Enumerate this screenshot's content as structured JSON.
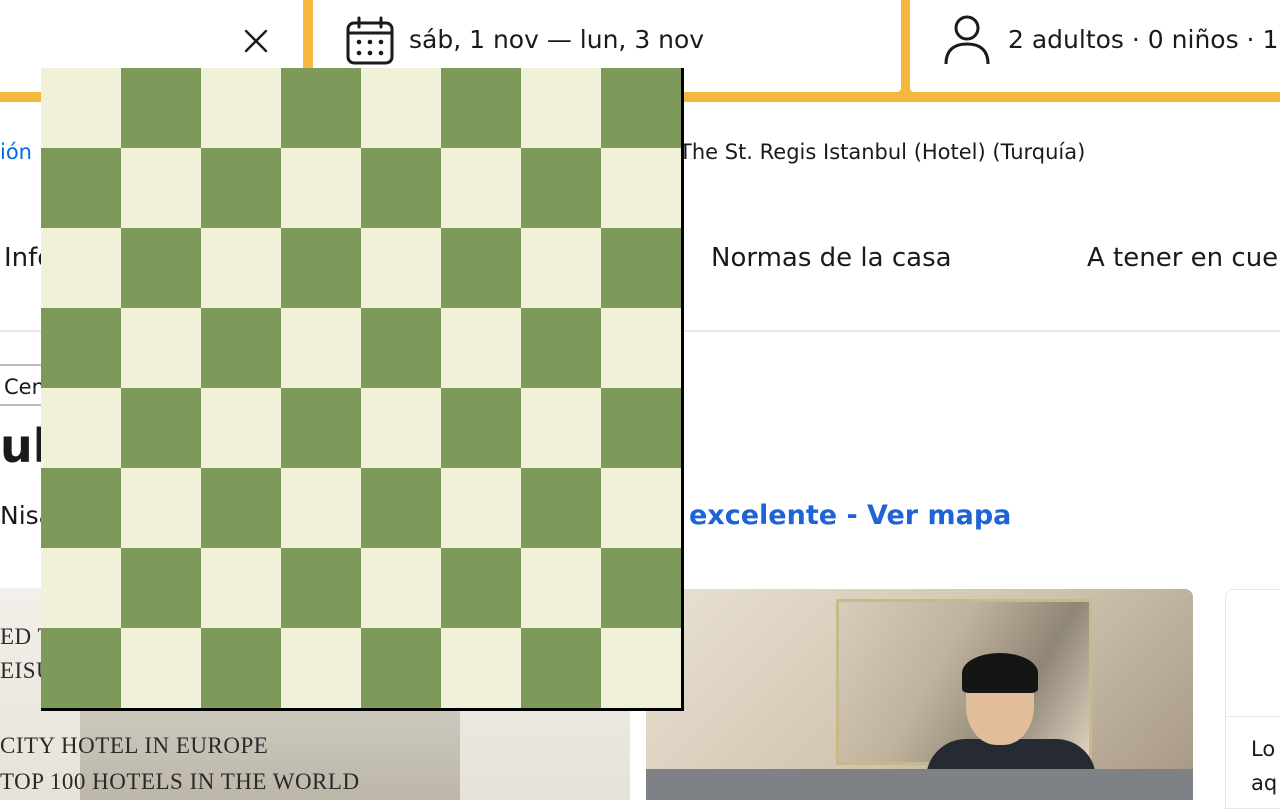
{
  "search": {
    "dates_label": "sáb, 1 nov  —  lun, 3 nov",
    "guests_label": "2 adultos · 0 niños · 1"
  },
  "breadcrumb": {
    "link_fragment": "ión",
    "current": "The St. Regis Istanbul (Hotel) (Turquía)"
  },
  "tabs": {
    "info": "Info",
    "house_rules": "Normas de la casa",
    "notice": "A tener en cuenta"
  },
  "property": {
    "badge_fragment": "Cen",
    "title_fragment": "ul",
    "address_fragment": "Nisa",
    "map_link": "excelente - Ver mapa"
  },
  "photos": {
    "caption_lines": [
      "ED T",
      "EISU",
      "CITY HOTEL IN EUROPE",
      "TOP 100 HOTELS IN THE WORLD"
    ]
  },
  "side_card": {
    "snippet_lines": [
      "Lo",
      "aq"
    ]
  },
  "chessboard": {
    "rows": 8,
    "cols": 8,
    "light_color": "#f0f1d8",
    "dark_color": "#7e9a5b",
    "top_left": "light"
  },
  "colors": {
    "search_bar": "#f5b83d",
    "link": "#006ce4",
    "map_link": "#1f64d6"
  }
}
